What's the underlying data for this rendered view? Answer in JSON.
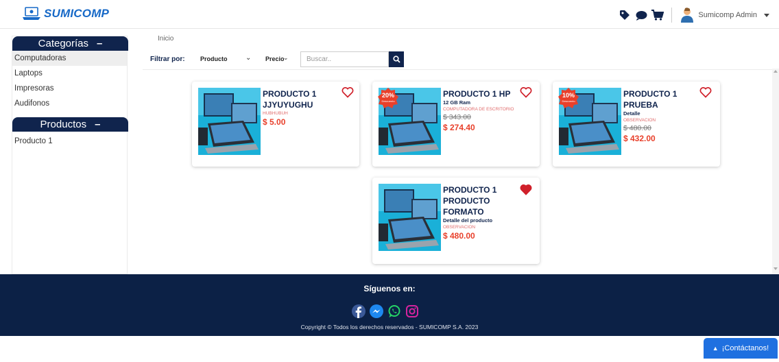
{
  "brand": {
    "name": "SUMICOMP"
  },
  "user": {
    "name": "Sumicomp Admin"
  },
  "nav_icons": [
    "tag-icon",
    "comment-icon",
    "cart-icon"
  ],
  "sidebar": {
    "categories_title": "Categorías",
    "categories": [
      "Computadoras",
      "Laptops",
      "Impresoras",
      "Audifonos"
    ],
    "products_title": "Productos",
    "products": [
      "Producto 1"
    ],
    "collapse_symbol": "–"
  },
  "breadcrumb": "Inicio",
  "filters": {
    "label": "Filtrar por:",
    "producto": "Producto",
    "precio": "Precio",
    "search_placeholder": "Buscar.."
  },
  "products": [
    {
      "name": "PRODUCTO 1 JJYUYUGHU",
      "detail": "",
      "category": "HUBHUBUH",
      "old_price": "",
      "price": "$ 5.00",
      "discount": "",
      "favorite": false
    },
    {
      "name": "PRODUCTO 1 HP",
      "detail": "12 GB Ram",
      "category": "COMPUTADORA DE ESCRITORIO",
      "old_price": "$ 343.00",
      "price": "$ 274.40",
      "discount": "20%",
      "favorite": false
    },
    {
      "name": "PRODUCTO 1 PRUEBA",
      "detail": "Detalle",
      "category": "OBSERVACION",
      "old_price": "$ 480.00",
      "price": "$ 432.00",
      "discount": "10%",
      "favorite": false
    },
    {
      "name": "PRODUCTO 1 PRODUCTO FORMATO",
      "detail": "Detalle del producto",
      "category": "OBSERVACION",
      "old_price": "",
      "price": "$ 480.00",
      "discount": "",
      "favorite": true
    }
  ],
  "discount_label": "Descuento",
  "footer": {
    "title": "Síguenos en:",
    "social": [
      "facebook-icon",
      "messenger-icon",
      "whatsapp-icon",
      "instagram-icon"
    ],
    "copyright": "Copyright © Todos los derechos reservados - SUMICOMP S.A. 2023"
  },
  "contact_button": "¡Contáctanos!",
  "colors": {
    "navy": "#10244d",
    "footer": "#0c2146",
    "price_red": "#e8402b",
    "heart_red": "#d0202a",
    "contact_blue": "#1f70e0"
  }
}
